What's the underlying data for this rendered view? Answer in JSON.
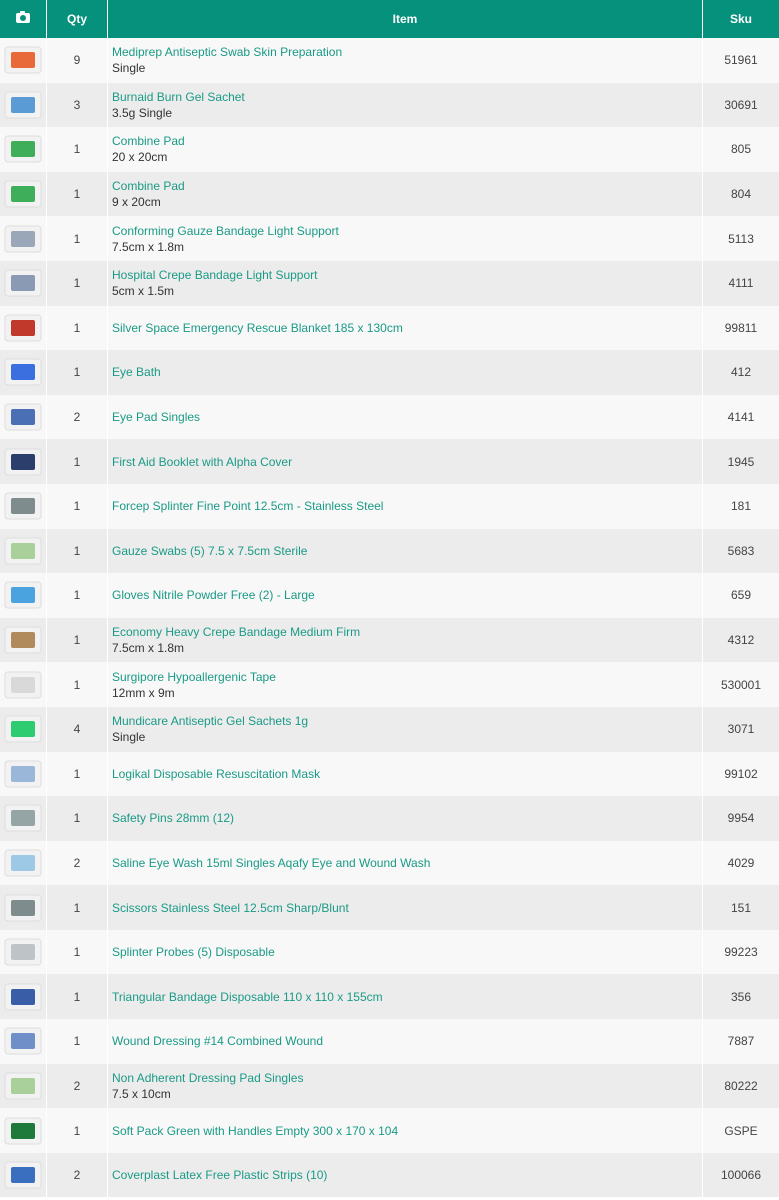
{
  "header": {
    "qty": "Qty",
    "item": "Item",
    "sku": "Sku",
    "camera_icon": "camera-icon"
  },
  "rows": [
    {
      "qty": "9",
      "name": "Mediprep Antiseptic Swab Skin Preparation",
      "variant": "Single",
      "sku": "51961",
      "thumb_color": "#e86a3a"
    },
    {
      "qty": "3",
      "name": "Burnaid Burn Gel Sachet",
      "variant": "3.5g Single",
      "sku": "30691",
      "thumb_color": "#5b9bd5"
    },
    {
      "qty": "1",
      "name": "Combine Pad",
      "variant": "20 x 20cm",
      "sku": "805",
      "thumb_color": "#3fae5b"
    },
    {
      "qty": "1",
      "name": "Combine Pad",
      "variant": "9 x 20cm",
      "sku": "804",
      "thumb_color": "#3fae5b"
    },
    {
      "qty": "1",
      "name": "Conforming Gauze Bandage Light Support",
      "variant": "7.5cm x 1.8m",
      "sku": "5113",
      "thumb_color": "#9aa7b8"
    },
    {
      "qty": "1",
      "name": "Hospital Crepe Bandage Light Support",
      "variant": "5cm x 1.5m",
      "sku": "4111",
      "thumb_color": "#8a9ab5"
    },
    {
      "qty": "1",
      "name": "Silver Space Emergency Rescue Blanket 185 x 130cm",
      "variant": "",
      "sku": "99811",
      "thumb_color": "#c0392b"
    },
    {
      "qty": "1",
      "name": "Eye Bath",
      "variant": "",
      "sku": "412",
      "thumb_color": "#3b6fe0"
    },
    {
      "qty": "2",
      "name": "Eye Pad Singles",
      "variant": "",
      "sku": "4141",
      "thumb_color": "#4a6fb5"
    },
    {
      "qty": "1",
      "name": "First Aid Booklet with Alpha Cover",
      "variant": "",
      "sku": "1945",
      "thumb_color": "#2c3e6b"
    },
    {
      "qty": "1",
      "name": "Forcep Splinter Fine Point 12.5cm - Stainless Steel",
      "variant": "",
      "sku": "181",
      "thumb_color": "#7f8c8d"
    },
    {
      "qty": "1",
      "name": "Gauze Swabs (5) 7.5 x 7.5cm Sterile",
      "variant": "",
      "sku": "5683",
      "thumb_color": "#a9cf9a"
    },
    {
      "qty": "1",
      "name": "Gloves Nitrile Powder Free (2) - Large",
      "variant": "",
      "sku": "659",
      "thumb_color": "#4aa3df"
    },
    {
      "qty": "1",
      "name": "Economy Heavy Crepe Bandage Medium Firm",
      "variant": "7.5cm x 1.8m",
      "sku": "4312",
      "thumb_color": "#b08a5a"
    },
    {
      "qty": "1",
      "name": "Surgipore Hypoallergenic Tape",
      "variant": "12mm x 9m",
      "sku": "530001",
      "thumb_color": "#d9d9d9"
    },
    {
      "qty": "4",
      "name": "Mundicare Antiseptic Gel Sachets 1g",
      "variant": "Single",
      "sku": "3071",
      "thumb_color": "#2ecc71"
    },
    {
      "qty": "1",
      "name": "Logikal Disposable Resuscitation Mask",
      "variant": "",
      "sku": "99102",
      "thumb_color": "#9ab6d8"
    },
    {
      "qty": "1",
      "name": "Safety Pins 28mm (12)",
      "variant": "",
      "sku": "9954",
      "thumb_color": "#95a5a6"
    },
    {
      "qty": "2",
      "name": "Saline Eye Wash 15ml Singles Aqafy Eye and Wound Wash",
      "variant": "",
      "sku": "4029",
      "thumb_color": "#9ec9e6"
    },
    {
      "qty": "1",
      "name": "Scissors Stainless Steel 12.5cm Sharp/Blunt",
      "variant": "",
      "sku": "151",
      "thumb_color": "#7f8c8d"
    },
    {
      "qty": "1",
      "name": "Splinter Probes (5) Disposable",
      "variant": "",
      "sku": "99223",
      "thumb_color": "#bdc3c7"
    },
    {
      "qty": "1",
      "name": "Triangular Bandage Disposable 110 x 110 x 155cm",
      "variant": "",
      "sku": "356",
      "thumb_color": "#3a5da8"
    },
    {
      "qty": "1",
      "name": "Wound Dressing #14 Combined Wound",
      "variant": "",
      "sku": "7887",
      "thumb_color": "#6f8fc9"
    },
    {
      "qty": "2",
      "name": "Non Adherent Dressing Pad Singles",
      "variant": "7.5 x 10cm",
      "sku": "80222",
      "thumb_color": "#a9cf9a"
    },
    {
      "qty": "1",
      "name": "Soft Pack Green with Handles Empty 300 x 170 x 104",
      "variant": "",
      "sku": "GSPE",
      "thumb_color": "#1e7a3a"
    },
    {
      "qty": "2",
      "name": "Coverplast Latex Free Plastic Strips (10)",
      "variant": "",
      "sku": "100066",
      "thumb_color": "#3a6fc0"
    }
  ]
}
